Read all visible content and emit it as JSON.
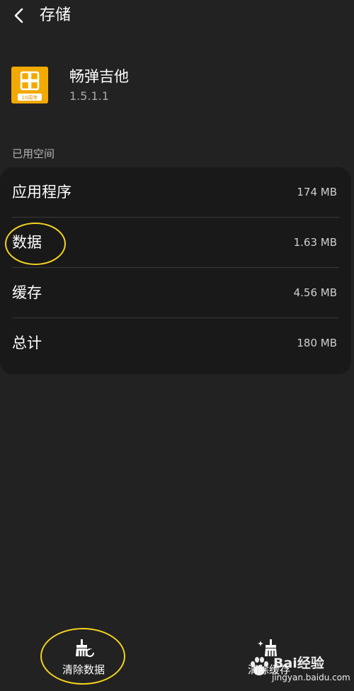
{
  "header": {
    "title": "存储"
  },
  "app": {
    "name": "畅弹吉他",
    "version": "1.5.1.1",
    "icon_caption": "10周年",
    "icon_color": "#f2a900"
  },
  "storage": {
    "section_label": "已用空间",
    "rows": [
      {
        "label": "应用程序",
        "value": "174 MB"
      },
      {
        "label": "数据",
        "value": "1.63 MB"
      },
      {
        "label": "缓存",
        "value": "4.56 MB"
      },
      {
        "label": "总计",
        "value": "180 MB"
      }
    ]
  },
  "actions": {
    "clear_data": "清除数据",
    "clear_cache": "清除缓存"
  },
  "watermark": {
    "brand": "Bai经验",
    "url": "jingyan.baidu.com"
  },
  "colors": {
    "background": "#222222",
    "card": "#191919",
    "highlight": "#f4d21f"
  }
}
